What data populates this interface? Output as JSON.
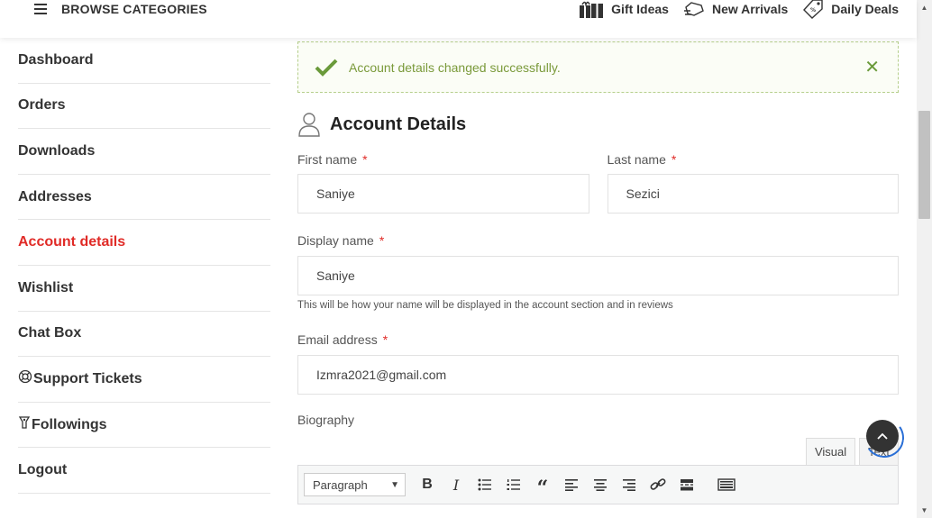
{
  "header": {
    "browse_label": "BROWSE CATEGORIES",
    "links": [
      {
        "label": "Gift Ideas",
        "icon": "gift-icon"
      },
      {
        "label": "New Arrivals",
        "icon": "new-arrivals-icon"
      },
      {
        "label": "Daily Deals",
        "icon": "price-tag-icon"
      }
    ]
  },
  "sidebar": {
    "items": [
      {
        "label": "Dashboard"
      },
      {
        "label": "Orders"
      },
      {
        "label": "Downloads"
      },
      {
        "label": "Addresses"
      },
      {
        "label": "Account details",
        "active": true
      },
      {
        "label": "Wishlist"
      },
      {
        "label": "Chat Box"
      },
      {
        "label": "Support Tickets",
        "icon": "lifebuoy-icon"
      },
      {
        "label": "Followings",
        "icon": "follow-icon"
      },
      {
        "label": "Logout"
      }
    ]
  },
  "notice": {
    "message": "Account details changed successfully.",
    "close": "✕"
  },
  "account": {
    "title": "Account Details",
    "first_name_label": "First name",
    "first_name_value": "Saniye",
    "last_name_label": "Last name",
    "last_name_value": "Sezici",
    "display_name_label": "Display name",
    "display_name_value": "Saniye",
    "display_name_help": "This will be how your name will be displayed in the account section and in reviews",
    "email_label": "Email address",
    "email_value": "Izmra2021@gmail.com",
    "required_mark": "*",
    "biography_label": "Biography"
  },
  "editor": {
    "tab_visual": "Visual",
    "tab_text": "Text",
    "format_value": "Paragraph",
    "buttons": [
      "bold",
      "italic",
      "bullet-list",
      "numbered-list",
      "blockquote",
      "align-left",
      "align-center",
      "align-right",
      "link",
      "read-more",
      "toolbar-toggle"
    ]
  },
  "colors": {
    "accent": "#e02b27",
    "success": "#7a9a3a",
    "success_border": "#b6cf8c"
  }
}
